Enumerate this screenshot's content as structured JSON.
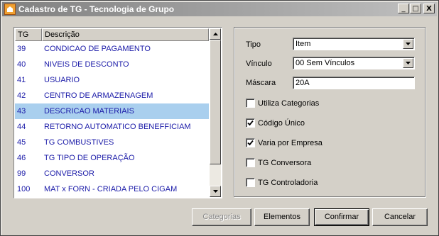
{
  "window": {
    "title": "Cadastro de TG - Tecnologia de Grupo"
  },
  "titlebar_buttons": {
    "minimize": "_",
    "maximize": "□",
    "close": "X"
  },
  "list": {
    "headers": {
      "tg": "TG",
      "description": "Descrição"
    },
    "rows": [
      {
        "tg": "39",
        "description": "CONDICAO DE PAGAMENTO"
      },
      {
        "tg": "40",
        "description": "NIVEIS DE DESCONTO"
      },
      {
        "tg": "41",
        "description": "USUARIO"
      },
      {
        "tg": "42",
        "description": "CENTRO DE ARMAZENAGEM"
      },
      {
        "tg": "43",
        "description": "DESCRICAO MATERIAIS",
        "selected": true
      },
      {
        "tg": "44",
        "description": "RETORNO AUTOMATICO BENEFFICIAM"
      },
      {
        "tg": "45",
        "description": "TG COMBUSTIVES"
      },
      {
        "tg": "46",
        "description": "TG TIPO DE OPERAÇÃO"
      },
      {
        "tg": "99",
        "description": "CONVERSOR"
      },
      {
        "tg": "100",
        "description": "MAT x FORN - CRIADA PELO CIGAM"
      }
    ]
  },
  "form": {
    "tipo": {
      "label": "Tipo",
      "value": "Item"
    },
    "vinculo": {
      "label": "Vínculo",
      "value": "00 Sem Vínculos"
    },
    "mascara": {
      "label": "Máscara",
      "value": "20A"
    },
    "checks": [
      {
        "label": "Utiliza Categorias",
        "checked": false
      },
      {
        "label": "Código Único",
        "checked": true
      },
      {
        "label": "Varia por Empresa",
        "checked": true
      },
      {
        "label": "TG Conversora",
        "checked": false
      },
      {
        "label": "TG Controladoria",
        "checked": false
      }
    ]
  },
  "buttons": {
    "categorias": "Categorias",
    "elementos": "Elementos",
    "confirmar": "Confirmar",
    "cancelar": "Cancelar"
  },
  "colors": {
    "list_text": "#1a1aa8",
    "selection": "#a9cfee"
  }
}
